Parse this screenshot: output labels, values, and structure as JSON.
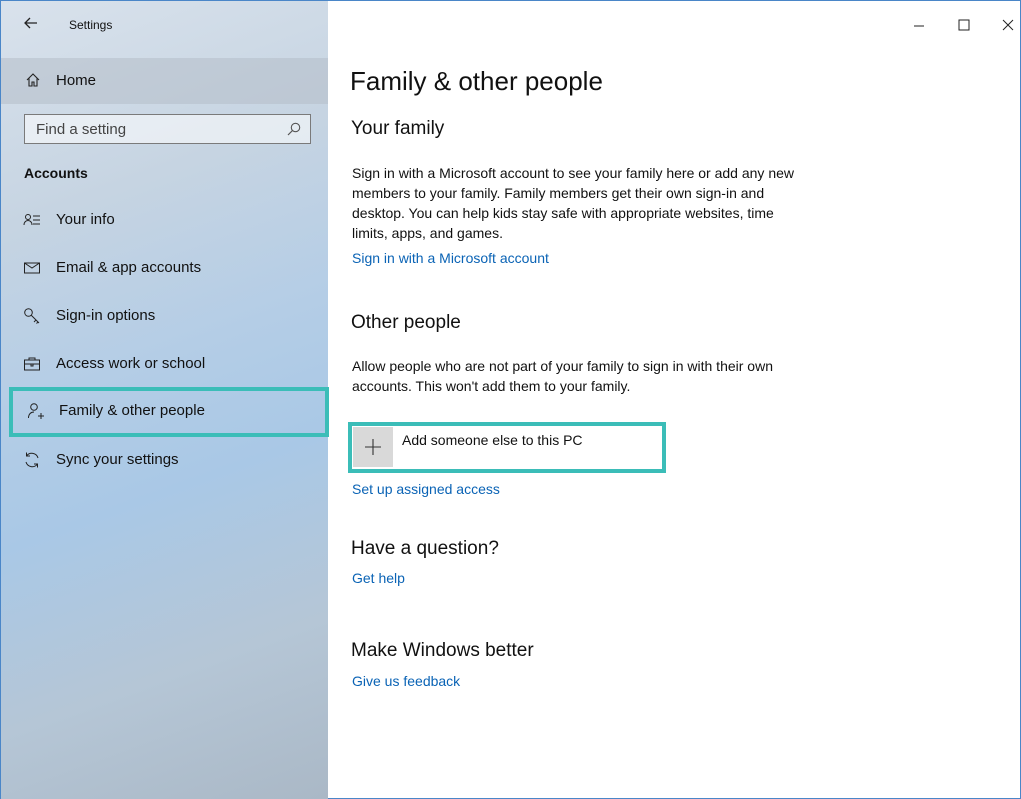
{
  "window": {
    "app_title": "Settings",
    "controls": {
      "minimize": "—",
      "maximize": "☐",
      "close": "✕"
    }
  },
  "sidebar": {
    "home_label": "Home",
    "search_placeholder": "Find a setting",
    "section_title": "Accounts",
    "items": [
      {
        "label": "Your info",
        "icon": "person-info-icon"
      },
      {
        "label": "Email & app accounts",
        "icon": "mail-icon"
      },
      {
        "label": "Sign-in options",
        "icon": "key-icon"
      },
      {
        "label": "Access work or school",
        "icon": "briefcase-icon"
      },
      {
        "label": "Family & other people",
        "icon": "person-add-icon",
        "selected": true
      },
      {
        "label": "Sync your settings",
        "icon": "sync-icon"
      }
    ]
  },
  "main": {
    "page_title": "Family & other people",
    "your_family": {
      "heading": "Your family",
      "body": "Sign in with a Microsoft account to see your family here or add any new members to your family. Family members get their own sign-in and desktop. You can help kids stay safe with appropriate websites, time limits, apps, and games.",
      "link": "Sign in with a Microsoft account"
    },
    "other_people": {
      "heading": "Other people",
      "body": "Allow people who are not part of your family to sign in with their own accounts. This won't add them to your family.",
      "add_button": "Add someone else to this PC",
      "link": "Set up assigned access"
    },
    "question": {
      "heading": "Have a question?",
      "link": "Get help"
    },
    "better": {
      "heading": "Make Windows better",
      "link": "Give us feedback"
    }
  },
  "colors": {
    "accent_highlight": "#3bbdb8",
    "link": "#0a63b5"
  }
}
